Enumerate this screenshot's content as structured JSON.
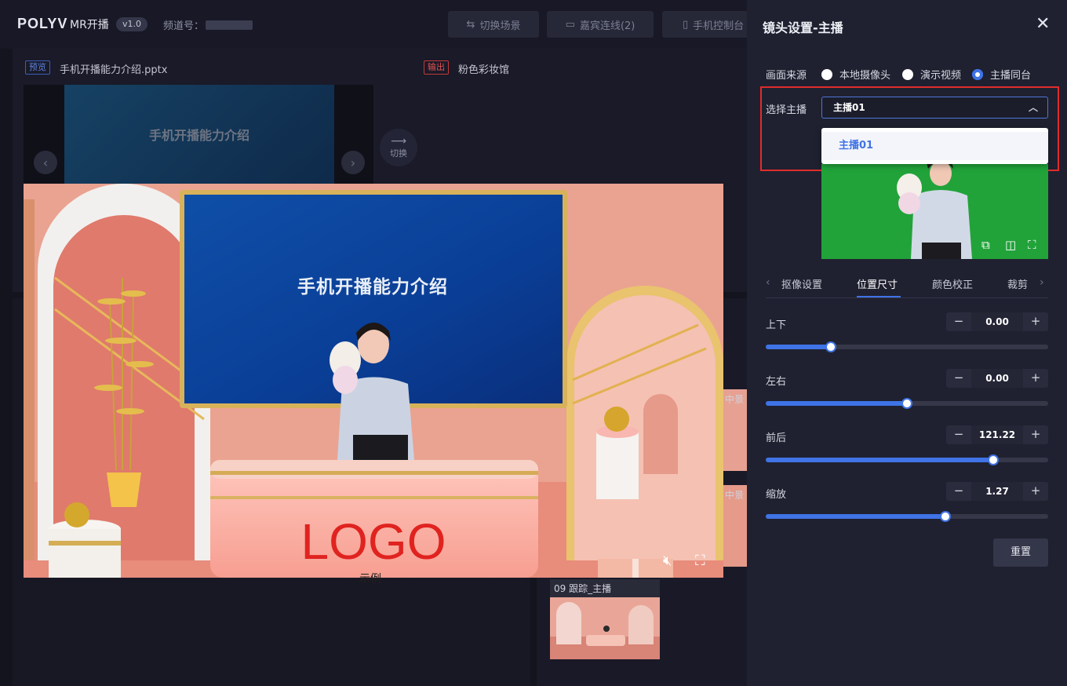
{
  "app": {
    "logo": "POLYV",
    "name": "MR开播",
    "version": "v1.0",
    "channel_label": "频道号："
  },
  "toolbar": {
    "switch_scene": "切换场景",
    "guest_connect": "嘉宾连线(2)",
    "phone_console": "手机控制台"
  },
  "preview": {
    "tag": "预览",
    "title": "手机开播能力介绍.pptx",
    "slide_text": "手机开播能力介绍"
  },
  "output": {
    "tag": "输出",
    "title": "粉色彩妆馆"
  },
  "switch": {
    "label": "切换"
  },
  "stage": {
    "screen_text": "手机开播能力介绍",
    "logo_text": "LOGO",
    "caption": "示例"
  },
  "scenes": [
    {
      "label": "中景"
    },
    {
      "label": "中景"
    },
    {
      "label": "09 跟踪_主播"
    }
  ],
  "drawer": {
    "title": "镜头设置-主播",
    "source_label": "画面来源",
    "sources": [
      {
        "label": "本地摄像头",
        "selected": false
      },
      {
        "label": "演示视频",
        "selected": false
      },
      {
        "label": "主播同台",
        "selected": true
      }
    ],
    "anchor_label": "选择主播",
    "anchor_selected": "主播01",
    "anchor_options": [
      "主播01"
    ],
    "tabs": [
      "抠像设置",
      "位置尺寸",
      "颜色校正",
      "裁剪"
    ],
    "active_tab": "位置尺寸",
    "params": [
      {
        "label": "上下",
        "value": "0.00",
        "level": 0.23
      },
      {
        "label": "左右",
        "value": "0.00",
        "level": 0.5
      },
      {
        "label": "前后",
        "value": "121.22",
        "level": 0.805
      },
      {
        "label": "缩放",
        "value": "1.27",
        "level": 0.635
      }
    ],
    "reset": "重置"
  },
  "colors": {
    "accent": "#3f73e6",
    "highlight": "#e12c2c",
    "green_screen": "#1fa038"
  }
}
